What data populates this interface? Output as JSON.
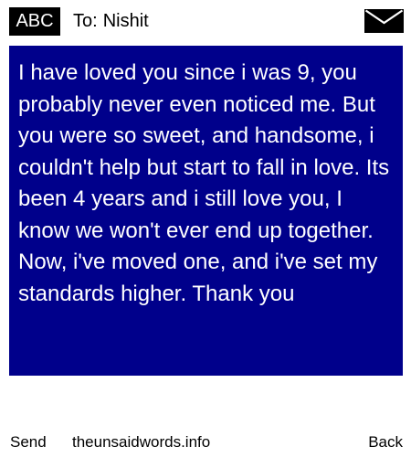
{
  "header": {
    "input_mode": "ABC",
    "to_label": "To:",
    "recipient": "Nishit",
    "icon": "envelope-icon"
  },
  "message": {
    "body": "I have loved you since i was 9, you probably never even noticed me. But you were so sweet, and handsome, i couldn't help but start to fall in love. Its been 4 years and i still love you, I know we won't ever end up together. Now, i've moved one, and i've set my standards higher. Thank you",
    "background_color": "#00008b",
    "text_color": "#ffffff"
  },
  "softkeys": {
    "left": "Send",
    "center": "theunsaidwords.info",
    "right": "Back"
  }
}
